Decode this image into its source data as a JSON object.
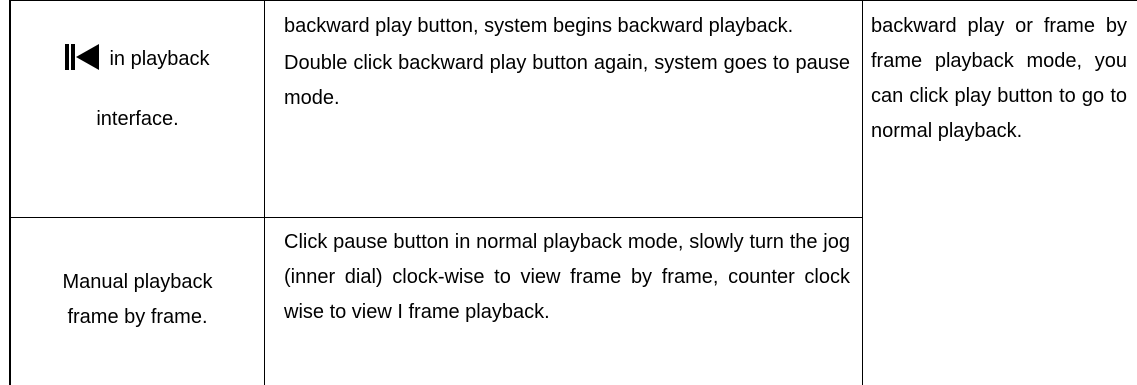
{
  "rows": [
    {
      "col1": {
        "icon": "backward-play-icon",
        "text_after_icon": "in playback",
        "line2": "interface."
      },
      "col2": {
        "para1": "backward play button, system begins backward playback.",
        "para2": "Double click backward play button again, system goes to pause mode."
      }
    },
    {
      "col1": {
        "line1": "Manual playback",
        "line2": "frame by frame."
      },
      "col2": {
        "para1": "Click pause button in normal playback mode, slowly turn the jog (inner dial) clock-wise to view frame by frame, counter clock wise to view I frame playback."
      }
    }
  ],
  "col3": {
    "text": "backward play or frame by frame playback mode, you can click play button to go to normal playback."
  }
}
